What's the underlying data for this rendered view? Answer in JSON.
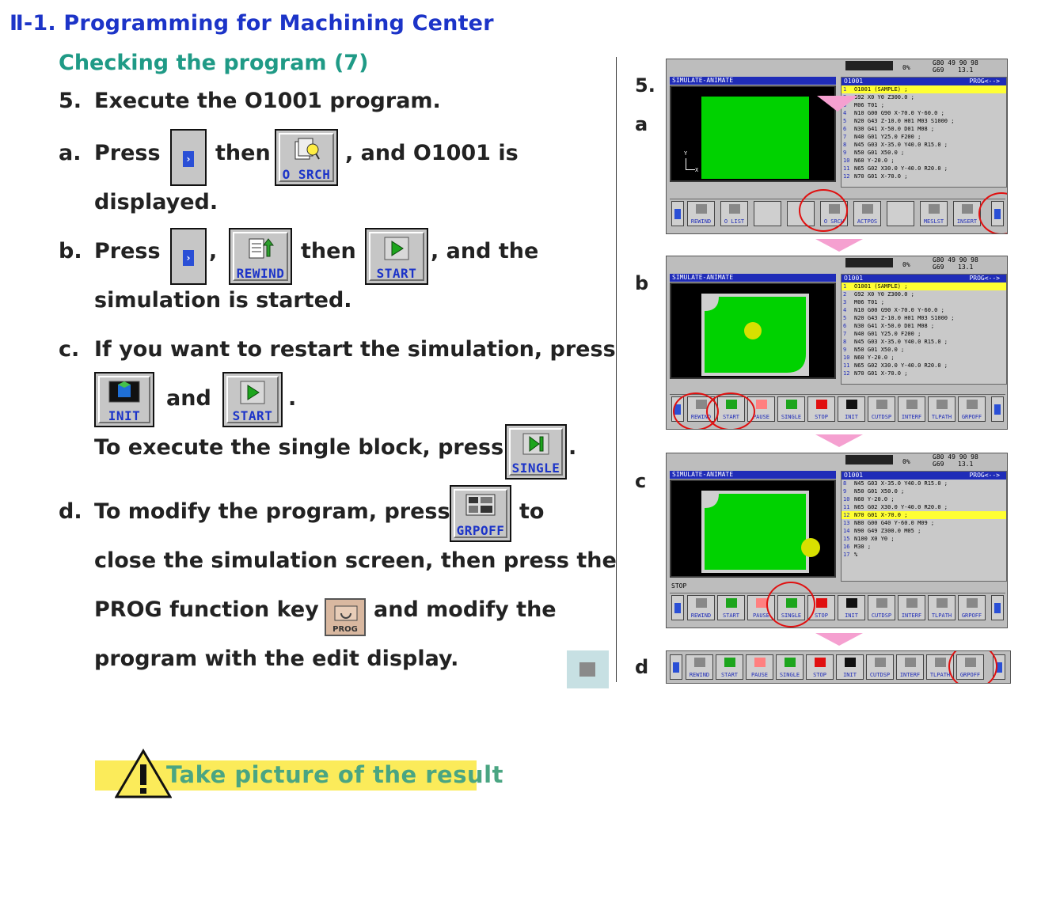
{
  "heading": "Ⅱ-1. Programming for Machining Center",
  "subheading": "Checking the program (7)",
  "step5": {
    "num": "5.",
    "text": "Execute the O1001 program."
  },
  "a": {
    "mark": "a.",
    "press": "Press",
    "then": "then",
    "tail": ", and O1001 is",
    "line2": "displayed."
  },
  "b": {
    "mark": "b.",
    "press": "Press",
    "comma": ",",
    "then": "then",
    "tail": ", and the",
    "line2": "simulation is started."
  },
  "c": {
    "mark": "c.",
    "text": "If you want to restart the simulation, press",
    "and": "and",
    "period": ".",
    "single_text": "To execute the single block, press",
    "single_period": "."
  },
  "d": {
    "mark": "d.",
    "text1": "To modify the program, press",
    "to": "to",
    "line2": "close the simulation screen, then press the",
    "line3a": "PROG function key",
    "line3b": "and modify the",
    "line4": "program with the edit display."
  },
  "keys": {
    "osrch": "O SRCH",
    "rewind": "REWIND",
    "start": "START",
    "init": "INIT",
    "single": "SINGLE",
    "grpoff": "GRPOFF",
    "prog": "PROG"
  },
  "right_labels": {
    "five": "5.",
    "a": "a",
    "b": "b",
    "c": "c",
    "d": "d"
  },
  "screen": {
    "sim_title": "SIMULATE-ANIMATE",
    "prog_title": "O1001",
    "prog_tag": "PROG<-->",
    "status_pct": "0%",
    "g_code": "G69",
    "g_val": "13.1",
    "g_top": "G80   49   90   98",
    "stop_label": "STOP",
    "lines_a": [
      {
        "n": "1",
        "t": "O1001 (SAMPLE) ;"
      },
      {
        "n": "2",
        "t": "G92 X0 Y0 Z300.0 ;"
      },
      {
        "n": "3",
        "t": "M06 T01 ;"
      },
      {
        "n": "4",
        "t": "N10 G00 G90 X-70.0 Y-60.0 ;"
      },
      {
        "n": "5",
        "t": "N20 G43 Z-10.0 H01 M03 S1000 ;"
      },
      {
        "n": "6",
        "t": "N30 G41 X-50.0 D01 M08 ;"
      },
      {
        "n": "7",
        "t": "N40 G01 Y25.0 F200 ;"
      },
      {
        "n": "8",
        "t": "N45 G03 X-35.0 Y40.0 R15.0 ;"
      },
      {
        "n": "9",
        "t": "N50 G01 X50.0 ;"
      },
      {
        "n": "10",
        "t": "N60 Y-20.0 ;"
      },
      {
        "n": "11",
        "t": "N65 G02 X30.0 Y-40.0 R20.0 ;"
      },
      {
        "n": "12",
        "t": "N70 G01 X-70.0 ;"
      }
    ],
    "lines_c": [
      {
        "n": "8",
        "t": "N45 G03 X-35.0 Y40.0 R15.0 ;"
      },
      {
        "n": "9",
        "t": "N50 G01 X50.0 ;"
      },
      {
        "n": "10",
        "t": "N60 Y-20.0 ;"
      },
      {
        "n": "11",
        "t": "N65 G02 X30.0 Y-40.0 R20.0 ;"
      },
      {
        "n": "12",
        "t": "N70 G01 X-70.0 ;"
      },
      {
        "n": "13",
        "t": "N80 G00 G40 Y-60.0 M09 ;"
      },
      {
        "n": "14",
        "t": "N90 G49 Z300.0 M05 ;"
      },
      {
        "n": "15",
        "t": "N100 X0 Y0 ;"
      },
      {
        "n": "16",
        "t": "M30 ;"
      },
      {
        "n": "17",
        "t": "%"
      }
    ],
    "softkeys_a": [
      "REWIND",
      "O LIST",
      "",
      "",
      "O SRCH",
      "ACTPOS",
      "",
      "MESLST",
      "INSERT"
    ],
    "softkeys_b": [
      "REWIND",
      "START",
      "PAUSE",
      "SINGLE",
      "STOP",
      "INIT",
      "CUTDSP",
      "INTERF",
      "TLPATH",
      "GRPOFF"
    ]
  },
  "warning": "Take picture of the result",
  "colors": {
    "accent_blue": "#1c34c8",
    "teal": "#1f9a86",
    "sim_green": "#00d200",
    "highlight": "#ffff33",
    "circle_red": "#e01010",
    "warn_bg": "#fbeb5a"
  }
}
